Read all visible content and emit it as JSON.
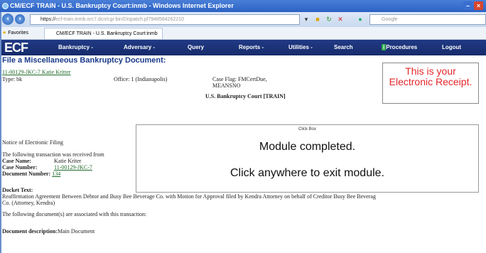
{
  "browser": {
    "title": "CM/ECF TRAIN - U.S. Bankruptcy Court:inmb - Windows Internet Explorer",
    "url_prefix": "https://",
    "url_host": "ecf-train.inmb.orc7.dcn",
    "url_path": "/cgi-bin/Dispatch.pl?948584262210",
    "search_placeholder": "Google",
    "favorites_label": "Favorites",
    "tab_label": "CM/ECF TRAIN - U.S. Bankruptcy Court:inmb"
  },
  "ecf_nav": {
    "logo": "ECF",
    "items": [
      "Bankruptcy -",
      "Adversary -",
      "Query",
      "Reports -",
      "Utilities -",
      "Search",
      "Procedures",
      "Logout"
    ]
  },
  "page": {
    "title": "File a Miscellaneous Bankruptcy Document:",
    "case_link": "11-00129-JKC-7 Katie Kritter",
    "type": "Type: bk",
    "office": "Office: 1 (Indianapolis)",
    "case_flag_line1": "Case Flag: FMCertDue,",
    "case_flag_line2": "MEANSNO",
    "court": "U.S. Bankruptcy Court [TRAIN]",
    "notice": "Notice of Electronic Filing",
    "received": "The following transaction was received from",
    "case_name_label": "Case Name:",
    "case_name_value": "Katie Kriter",
    "case_number_label": "Case Number:",
    "case_number_value": "11-00129-JKC-7",
    "document_number_label": "Document Number:",
    "document_number_value": "134",
    "docket_text_label": "Docket Text:",
    "docket_line1": "Reaffirmation Agreement Between Debtor and Busy Bee Beverage Co. with Motion for Approval filed by Kendra Attorney on behalf of Creditor Busy Bee Beverag",
    "docket_line2": "Co. (Attorney, Kendra)",
    "associated": "The following document(s) are associated with this transaction:",
    "doc_desc_label": "Document description:",
    "doc_desc_value": "Main Document"
  },
  "receipt_callout": "This is your Electronic Receipt.",
  "dialog": {
    "caption": "Click Box",
    "line1": "Module completed.",
    "line2": "Click anywhere to exit module."
  }
}
